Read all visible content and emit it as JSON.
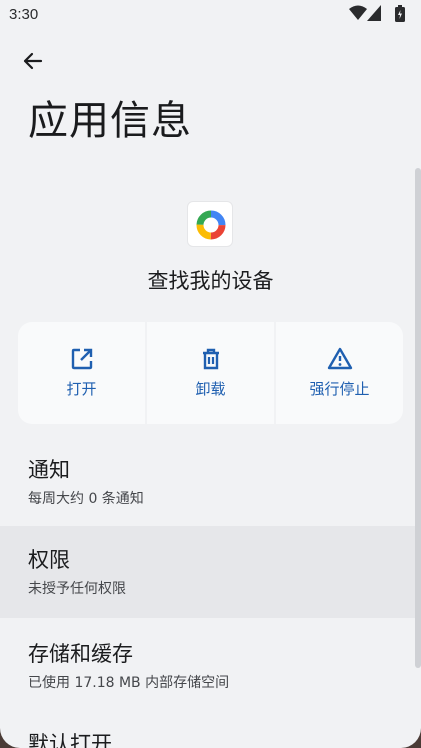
{
  "status_bar": {
    "time": "3:30",
    "icons": [
      "wifi-icon",
      "cell-signal-icon",
      "battery-icon"
    ]
  },
  "header": {
    "back_icon": "arrow-left-icon",
    "title": "应用信息"
  },
  "app": {
    "name": "查找我的设备",
    "icon": "find-my-device-icon"
  },
  "actions": [
    {
      "label": "打开",
      "icon": "open-external-icon"
    },
    {
      "label": "卸载",
      "icon": "trash-icon"
    },
    {
      "label": "强行停止",
      "icon": "warning-triangle-icon"
    }
  ],
  "preferences": [
    {
      "title": "通知",
      "summary": "每周大约 0 条通知"
    },
    {
      "title": "权限",
      "summary": "未授予任何权限"
    },
    {
      "title": "存储和缓存",
      "summary": "已使用 17.18 MB 内部存储空间"
    },
    {
      "title": "默认打开",
      "summary": ""
    }
  ],
  "colors": {
    "background": "#f1f2f4",
    "accent": "#1f5fb0",
    "highlight": "#e6e7ea"
  }
}
